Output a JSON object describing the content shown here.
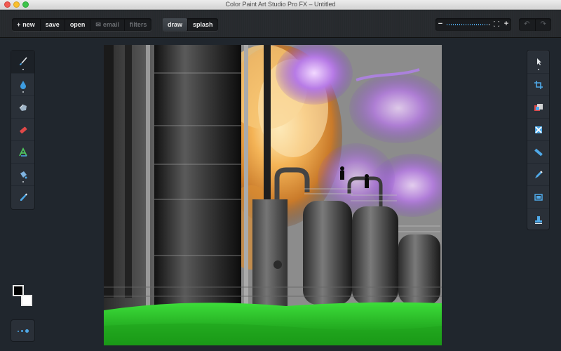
{
  "window": {
    "title": "Color Paint Art Studio Pro FX – Untitled"
  },
  "toolbar": {
    "file_buttons": [
      {
        "label": "new",
        "glyph": "+",
        "enabled": true
      },
      {
        "label": "save",
        "enabled": true
      },
      {
        "label": "open",
        "enabled": true
      },
      {
        "label": "email",
        "glyph": "✉",
        "enabled": false
      },
      {
        "label": "filters",
        "enabled": false
      }
    ],
    "mode_buttons": [
      {
        "label": "draw",
        "active": true
      },
      {
        "label": "splash",
        "active": false
      }
    ],
    "zoom": {
      "minus": "−",
      "plus": "+",
      "level": 0.95,
      "fit_icon": "fit-screen-icon"
    },
    "undo": {
      "undo_glyph": "↶",
      "redo_glyph": "↷",
      "enabled": false
    }
  },
  "left_tools": [
    {
      "name": "brush-tool",
      "icon": "paintbrush-icon",
      "selected": true
    },
    {
      "name": "blur-tool",
      "icon": "water-drop-icon",
      "selected": false
    },
    {
      "name": "smudge-tool",
      "icon": "smudge-hand-icon",
      "selected": false
    },
    {
      "name": "eraser-tool",
      "icon": "eraser-icon",
      "selected": false
    },
    {
      "name": "text-tool",
      "icon": "text-a-icon",
      "selected": false
    },
    {
      "name": "fill-tool",
      "icon": "paint-bucket-icon",
      "selected": false
    },
    {
      "name": "eyedropper-tool",
      "icon": "eyedropper-icon",
      "selected": false
    }
  ],
  "right_tools": [
    {
      "name": "pointer-tool",
      "icon": "arrow-pointer-icon"
    },
    {
      "name": "crop-tool",
      "icon": "crop-icon"
    },
    {
      "name": "color-balance-tool",
      "icon": "color-balance-icon"
    },
    {
      "name": "transform-tool",
      "icon": "transform-x-icon"
    },
    {
      "name": "ruler-tool",
      "icon": "ruler-icon"
    },
    {
      "name": "pencil-tool",
      "icon": "pencil-icon"
    },
    {
      "name": "frame-tool",
      "icon": "frame-icon"
    },
    {
      "name": "stamp-tool",
      "icon": "stamp-icon"
    }
  ],
  "colors": {
    "foreground": "#000000",
    "background": "#ffffff",
    "accent": "#4fa9e8"
  },
  "canvas": {
    "image": "industrial-towers-purple-sky-green-grass"
  }
}
